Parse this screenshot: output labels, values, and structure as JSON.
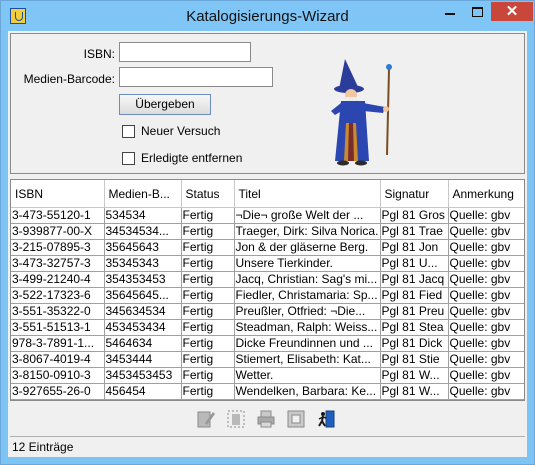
{
  "window": {
    "title": "Katalogisierungs-Wizard",
    "close_glyph": "✕"
  },
  "form": {
    "isbn_label": "ISBN:",
    "isbn_value": "",
    "barcode_label": "Medien-Barcode:",
    "barcode_value": "",
    "submit_label": "Übergeben",
    "retry_label": "Neuer Versuch",
    "retry_checked": false,
    "remove_done_label": "Erledigte entfernen",
    "remove_done_checked": false
  },
  "table": {
    "columns": [
      "ISBN",
      "Medien-B...",
      "Status",
      "Titel",
      "Signatur",
      "Anmerkung"
    ],
    "rows": [
      [
        "3-473-55120-1",
        "534534",
        "Fertig",
        "¬Die¬ große Welt der ...",
        "Pgl 81 Gros",
        "Quelle: gbv"
      ],
      [
        "3-939877-00-X",
        "34534534...",
        "Fertig",
        "Traeger, Dirk: Silva Norica.",
        "Pgl 81 Trae",
        "Quelle: gbv"
      ],
      [
        "3-215-07895-3",
        "35645643",
        "Fertig",
        "Jon & der gläserne Berg.",
        "Pgl 81 Jon",
        "Quelle: gbv"
      ],
      [
        "3-473-32757-3",
        "35345343",
        "Fertig",
        "Unsere Tierkinder.",
        "Pgl 81 U...",
        "Quelle: gbv"
      ],
      [
        "3-499-21240-4",
        "354353453",
        "Fertig",
        "Jacq, Christian: Sag's mi...",
        "Pgl 81 Jacq",
        "Quelle: gbv"
      ],
      [
        "3-522-17323-6",
        "35645645...",
        "Fertig",
        "Fiedler, Christamaria: Sp...",
        "Pgl 81 Fied",
        "Quelle: gbv"
      ],
      [
        "3-551-35322-0",
        "345634534",
        "Fertig",
        "Preußler, Otfried: ¬Die...",
        "Pgl 81 Preu",
        "Quelle: gbv"
      ],
      [
        "3-551-51513-1",
        "453453434",
        "Fertig",
        "Steadman, Ralph: Weiss...",
        "Pgl 81 Stea",
        "Quelle: gbv"
      ],
      [
        "978-3-7891-1...",
        "5464634",
        "Fertig",
        "Dicke Freundinnen und ...",
        "Pgl 81 Dick",
        "Quelle: gbv"
      ],
      [
        "3-8067-4019-4",
        "3453444",
        "Fertig",
        "Stiemert, Elisabeth: Kat...",
        "Pgl 81 Stie",
        "Quelle: gbv"
      ],
      [
        "3-8150-0910-3",
        "3453453453",
        "Fertig",
        "Wetter.",
        "Pgl 81 W...",
        "Quelle: gbv"
      ],
      [
        "3-927655-26-0",
        "456454",
        "Fertig",
        "Wendelken, Barbara: Ke...",
        "Pgl 81 W...",
        "Quelle: gbv"
      ]
    ]
  },
  "toolbar": {
    "icons": [
      "edit-icon",
      "select-all-icon",
      "print-icon",
      "frame-icon",
      "exit-icon"
    ]
  },
  "status": {
    "text": "12 Einträge"
  }
}
